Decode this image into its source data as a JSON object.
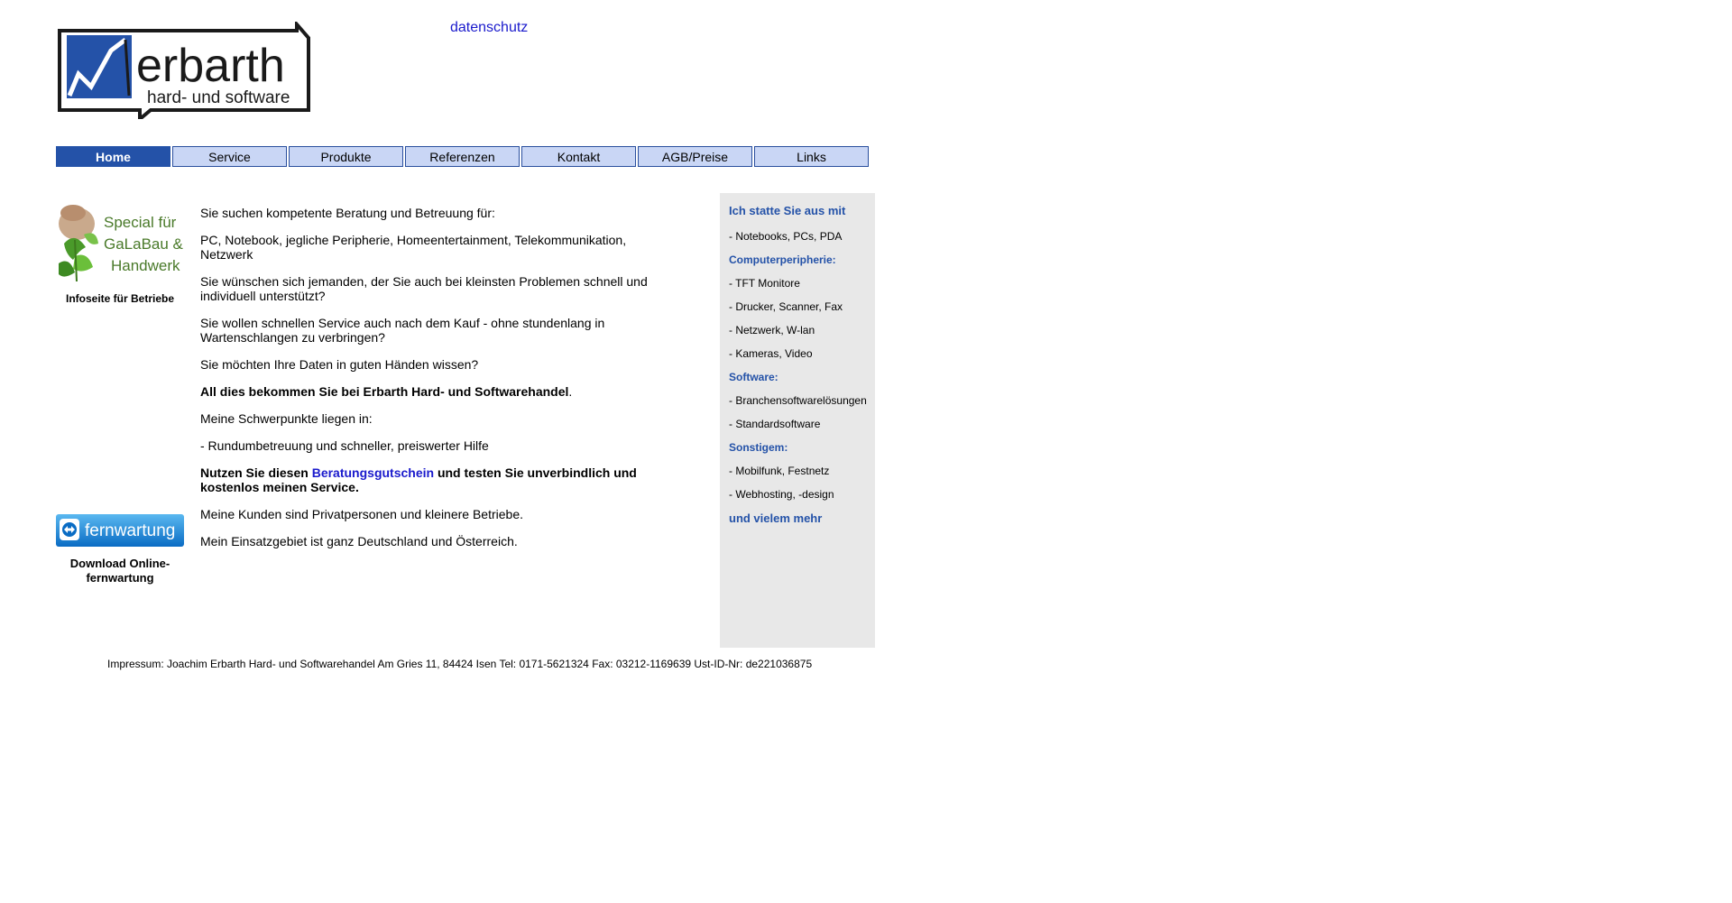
{
  "logo": {
    "name": "erbarth",
    "tagline": "hard- und software",
    "colors": {
      "box": "#2452a8",
      "border": "#1a1a1a"
    }
  },
  "header": {
    "link_datenschutz": "datenschutz"
  },
  "nav": {
    "items": [
      {
        "label": "Home",
        "active": true
      },
      {
        "label": "Service"
      },
      {
        "label": "Produkte"
      },
      {
        "label": "Referenzen"
      },
      {
        "label": "Kontakt"
      },
      {
        "label": "AGB/Preise"
      },
      {
        "label": "Links"
      }
    ]
  },
  "left": {
    "promo": {
      "line1": "Special für",
      "line2": "GaLaBau &",
      "line3": "Handwerk",
      "caption": "Infoseite für Betriebe"
    },
    "fernwartung": {
      "button_label": "fernwartung",
      "caption": "Download Online-fernwartung"
    }
  },
  "main": {
    "p1": "Sie suchen kompetente Beratung und Betreuung für:",
    "p2": "PC, Notebook, jegliche Peripherie, Homeentertainment, Telekommunikation, Netzwerk",
    "p3": "Sie wünschen sich jemanden, der Sie auch bei kleinsten Problemen schnell und individuell unterstützt?",
    "p4": "Sie wollen schnellen Service auch nach dem Kauf - ohne stundenlang in Wartenschlangen zu verbringen?",
    "p5": "Sie möchten Ihre Daten in guten Händen wissen?",
    "p6": "All dies bekommen Sie bei Erbarth Hard- und Softwarehandel",
    "p6_end": ".",
    "p7": "Meine Schwerpunkte liegen in:",
    "p8": "- Rundumbetreuung und schneller, preiswerter Hilfe",
    "p9_a": "Nutzen Sie diesen ",
    "p9_link": "Beratungsgutschein",
    "p9_b": " und testen Sie unverbindlich und kostenlos meinen Service.",
    "p10": "Meine Kunden sind Privatpersonen und kleinere Betriebe.",
    "p11": "Mein Einsatzgebiet ist ganz Deutschland und Österreich."
  },
  "sidebar": {
    "heading": "Ich statte  Sie aus mit",
    "item1": "- Notebooks, PCs, PDA",
    "sub1": "Computerperipherie:",
    "item2": "- TFT Monitore",
    "item3": "- Drucker, Scanner, Fax",
    "item4": "- Netzwerk, W-lan",
    "item5": "- Kameras, Video",
    "sub2": "Software:",
    "item6": "- Branchensoftwarelösungen",
    "item7": "- Standardsoftware",
    "sub3": "Sonstigem:",
    "item8": "- Mobilfunk, Festnetz",
    "item9": "- Webhosting, -design",
    "footer": "und vielem mehr"
  },
  "footer": {
    "impressum": "Impressum: Joachim Erbarth Hard- und Softwarehandel Am Gries 11, 84424 Isen Tel: 0171-5621324 Fax: 03212-1169639 Ust-ID-Nr: de221036875"
  }
}
